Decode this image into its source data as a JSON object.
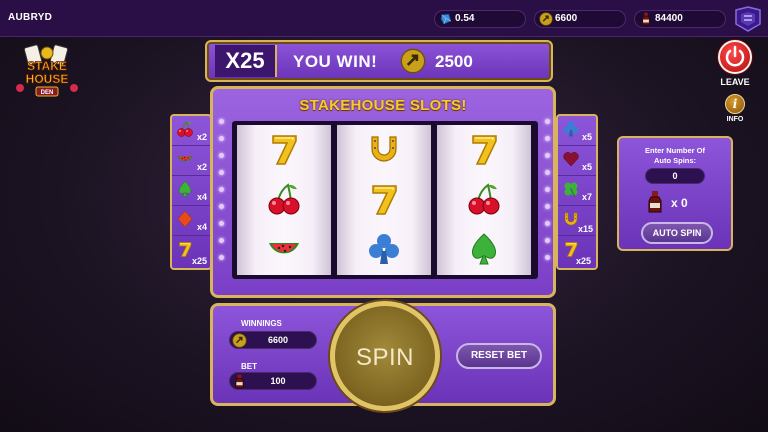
{
  "topbar": {
    "username": "AUBRYD",
    "gem_balance": "0.54",
    "coin_balance": "6600",
    "bottle_balance": "84400"
  },
  "logo": {
    "line1": "STAKE",
    "line2": "HOUSE",
    "line3": "DEN"
  },
  "controls": {
    "leave_label": "LEAVE",
    "info_glyph": "i",
    "info_label": "INFO"
  },
  "banner": {
    "multiplier": "X25",
    "win_text": "YOU WIN!",
    "win_amount": "2500"
  },
  "machine": {
    "title": "STAKEHOUSE SLOTS!",
    "reels": [
      [
        "seven-icon",
        "cherry-icon",
        "watermelon-icon"
      ],
      [
        "horseshoe-icon",
        "seven-icon",
        "club-icon"
      ],
      [
        "seven-icon",
        "cherry-icon",
        "spade-icon"
      ]
    ]
  },
  "paytable_left": [
    {
      "icon": "cherry-icon",
      "mult": "x2"
    },
    {
      "icon": "watermelon-icon",
      "mult": "x2"
    },
    {
      "icon": "spade-icon",
      "mult": "x4"
    },
    {
      "icon": "diamond-icon",
      "mult": "x4"
    },
    {
      "icon": "seven-icon",
      "mult": "x25"
    }
  ],
  "paytable_right": [
    {
      "icon": "club-icon",
      "mult": "x5"
    },
    {
      "icon": "heart-icon",
      "mult": "x5"
    },
    {
      "icon": "clover-icon",
      "mult": "x7"
    },
    {
      "icon": "horseshoe-icon",
      "mult": "x15"
    },
    {
      "icon": "seven-icon",
      "mult": "x25"
    }
  ],
  "autospin": {
    "label_line1": "Enter Number Of",
    "label_line2": "Auto Spins:",
    "input_value": "0",
    "bottle_count": "x 0",
    "button_label": "AUTO SPIN"
  },
  "bottom": {
    "winnings_label": "WINNINGS",
    "winnings_value": "6600",
    "bet_label": "BET",
    "bet_value": "100",
    "spin_label": "SPIN",
    "reset_label": "RESET BET"
  },
  "colors": {
    "accent_purple": "#7a3fc6",
    "gold": "#d8b45a",
    "title_yellow": "#f7c933"
  }
}
